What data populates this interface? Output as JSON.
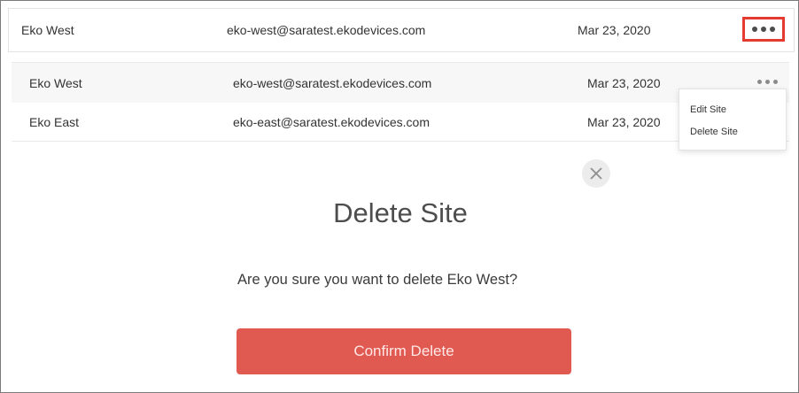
{
  "top_row": {
    "name": "Eko West",
    "email": "eko-west@saratest.ekodevices.com",
    "date": "Mar 23, 2020",
    "more_icon": "ellipsis-icon"
  },
  "table": {
    "rows": [
      {
        "name": "Eko West",
        "email": "eko-west@saratest.ekodevices.com",
        "date": "Mar 23, 2020"
      },
      {
        "name": "Eko East",
        "email": "eko-east@saratest.ekodevices.com",
        "date": "Mar 23, 2020"
      }
    ]
  },
  "menu": {
    "items": [
      {
        "label": "Edit Site"
      },
      {
        "label": "Delete Site"
      }
    ]
  },
  "modal": {
    "close_icon": "close-icon",
    "title": "Delete Site",
    "message": "Are you sure you want to delete Eko West?",
    "confirm_label": "Confirm Delete"
  },
  "colors": {
    "highlight_border": "#e53a2f",
    "confirm_button": "#e05a52"
  }
}
